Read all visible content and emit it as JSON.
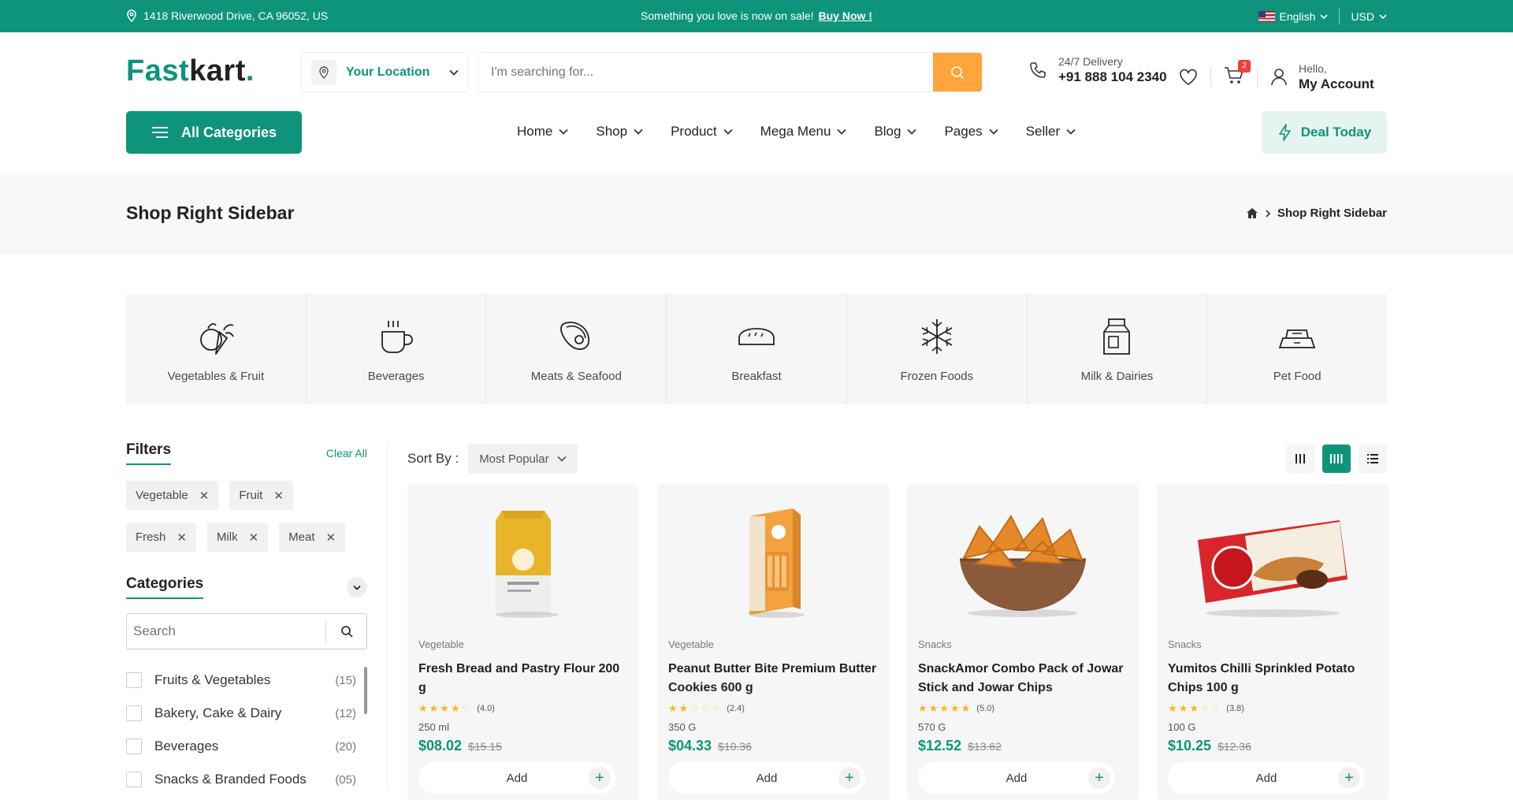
{
  "topbar": {
    "address": "1418 Riverwood Drive, CA 96052, US",
    "promo": "Something you love is now on sale!",
    "promo_link": "Buy Now !",
    "language": "English",
    "currency": "USD"
  },
  "header": {
    "logo_a": "Fast",
    "logo_b": "kart",
    "logo_dot": ".",
    "location_label": "Your Location",
    "search_placeholder": "I'm searching for...",
    "delivery_label": "24/7 Delivery",
    "delivery_phone": "+91 888 104 2340",
    "cart_count": "2",
    "account_greeting": "Hello,",
    "account_label": "My Account"
  },
  "nav": {
    "all_categories": "All Categories",
    "menu": [
      "Home",
      "Shop",
      "Product",
      "Mega Menu",
      "Blog",
      "Pages",
      "Seller"
    ],
    "deal": "Deal Today"
  },
  "page": {
    "title": "Shop Right Sidebar",
    "crumb_current": "Shop Right Sidebar"
  },
  "categories": [
    {
      "label": "Vegetables & Fruit",
      "icon": "vegetables-icon"
    },
    {
      "label": "Beverages",
      "icon": "cup-icon"
    },
    {
      "label": "Meats & Seafood",
      "icon": "steak-icon"
    },
    {
      "label": "Breakfast",
      "icon": "bread-icon"
    },
    {
      "label": "Frozen Foods",
      "icon": "snowflake-icon"
    },
    {
      "label": "Milk & Dairies",
      "icon": "milk-carton-icon"
    },
    {
      "label": "Pet Food",
      "icon": "pet-bowl-icon"
    }
  ],
  "filters": {
    "title": "Filters",
    "clear": "Clear All",
    "chips": [
      "Vegetable",
      "Fruit",
      "Fresh",
      "Milk",
      "Meat"
    ],
    "categories_title": "Categories",
    "search_placeholder": "Search",
    "category_list": [
      {
        "label": "Fruits & Vegetables",
        "count": "(15)"
      },
      {
        "label": "Bakery, Cake & Dairy",
        "count": "(12)"
      },
      {
        "label": "Beverages",
        "count": "(20)"
      },
      {
        "label": "Snacks & Branded Foods",
        "count": "(05)"
      }
    ]
  },
  "toolbar": {
    "sort_label": "Sort By :",
    "sort_value": "Most Popular"
  },
  "products": [
    {
      "type": "Vegetable",
      "name": "Fresh Bread and Pastry Flour 200 g",
      "rating": 4,
      "rating_text": "(4.0)",
      "unit": "250 ml",
      "price": "$08.02",
      "old_price": "$15.15",
      "add": "Add"
    },
    {
      "type": "Vegetable",
      "name": "Peanut Butter Bite Premium Butter Cookies 600 g",
      "rating": 2,
      "rating_text": "(2.4)",
      "unit": "350 G",
      "price": "$04.33",
      "old_price": "$10.36",
      "add": "Add"
    },
    {
      "type": "Snacks",
      "name": "SnackAmor Combo Pack of Jowar Stick and Jowar Chips",
      "rating": 5,
      "rating_text": "(5.0)",
      "unit": "570 G",
      "price": "$12.52",
      "old_price": "$13.62",
      "add": "Add"
    },
    {
      "type": "Snacks",
      "name": "Yumitos Chilli Sprinkled Potato Chips 100 g",
      "rating": 3,
      "rating_text": "(3.8)",
      "unit": "100 G",
      "price": "$10.25",
      "old_price": "$12.36",
      "add": "Add"
    }
  ],
  "colors": {
    "brand": "#0e947a",
    "accent": "#ffa53b",
    "badge": "#ef3f3e"
  }
}
